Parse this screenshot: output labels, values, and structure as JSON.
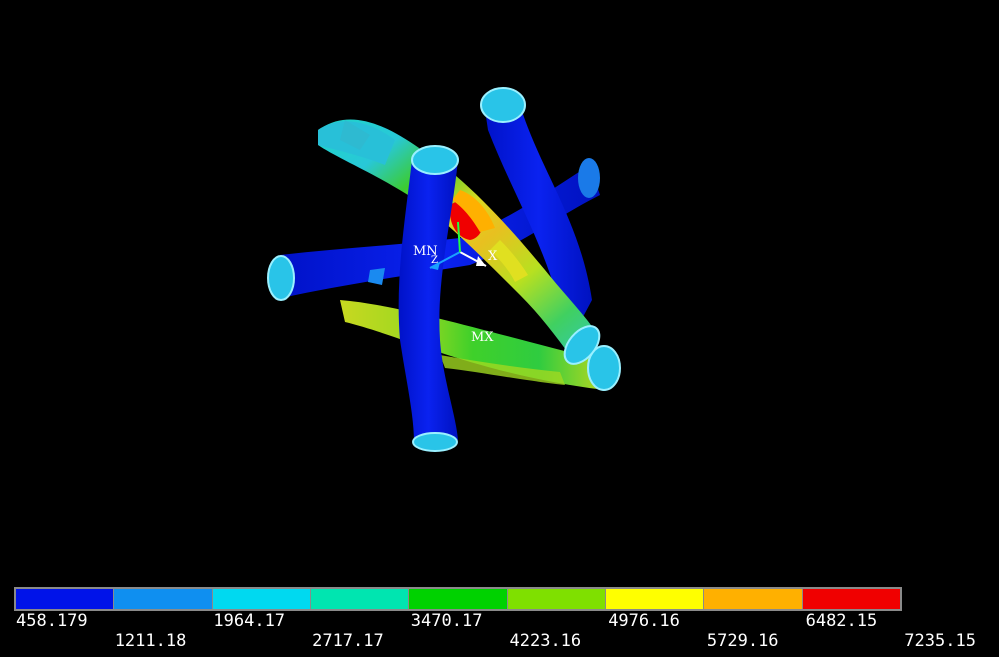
{
  "viewport": {
    "model": "deformed-tube-lattice",
    "labels": {
      "min_marker": "MN",
      "max_marker": "MX",
      "axis_x": "X",
      "axis_z": "Z"
    },
    "colors": {
      "background": "#000000",
      "tube_low": "#0016d8",
      "tube_cap": "#29c4e8"
    }
  },
  "legend": {
    "colors": [
      "#0013e9",
      "#0f8ff0",
      "#00d9f0",
      "#00e5b0",
      "#00d200",
      "#7fe000",
      "#ffff00",
      "#ffb000",
      "#f00000"
    ],
    "values_top": [
      "458.179",
      "1964.17",
      "3470.17",
      "4976.16",
      "6482.15"
    ],
    "values_bottom": [
      "1211.18",
      "2717.17",
      "4223.16",
      "5729.16",
      "7235.15"
    ]
  }
}
